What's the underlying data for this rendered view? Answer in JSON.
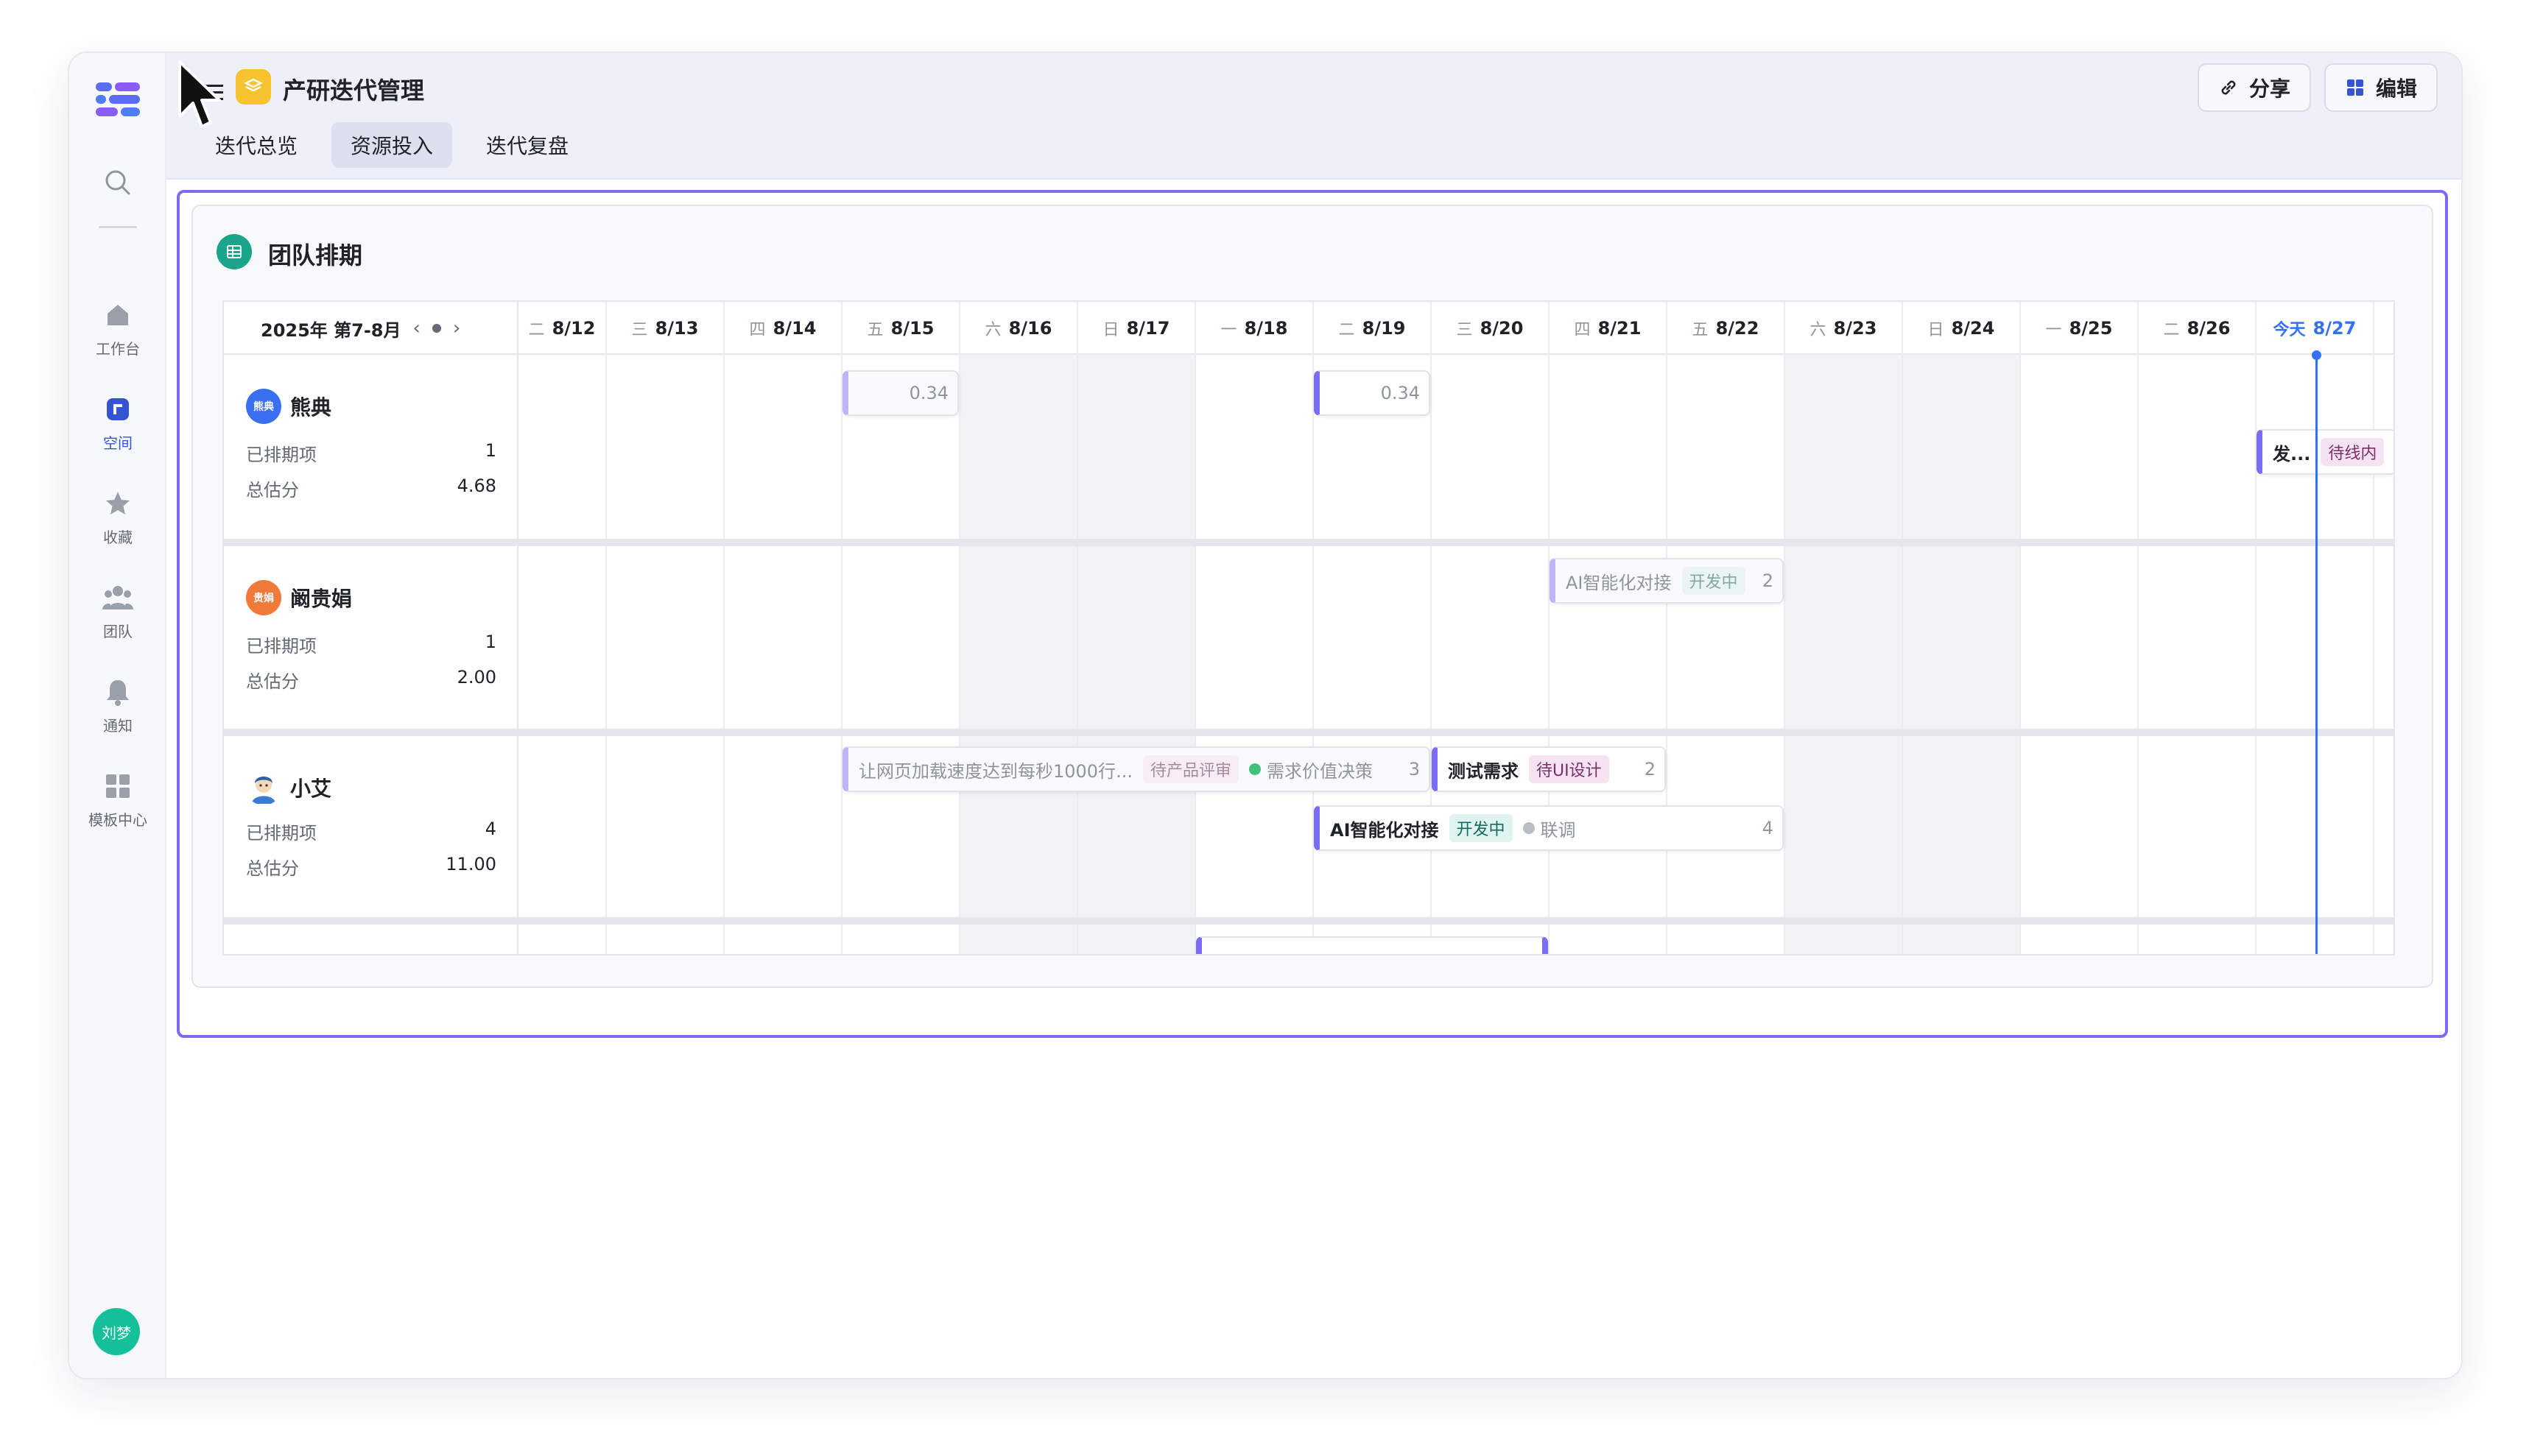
{
  "nav": {
    "items": [
      {
        "label": "工作台",
        "icon": "home-icon"
      },
      {
        "label": "空间",
        "icon": "space-icon"
      },
      {
        "label": "收藏",
        "icon": "star-icon"
      },
      {
        "label": "团队",
        "icon": "team-icon"
      },
      {
        "label": "通知",
        "icon": "bell-icon"
      },
      {
        "label": "模板中心",
        "icon": "template-icon"
      }
    ],
    "user_avatar": "刘梦"
  },
  "header": {
    "title": "产研迭代管理",
    "tabs": [
      "迭代总览",
      "资源投入",
      "迭代复盘"
    ],
    "active_tab": "资源投入",
    "share_label": "分享",
    "edit_label": "编辑"
  },
  "card": {
    "title": "团队排期"
  },
  "gantt": {
    "period": "2025年 第7-8月",
    "days": [
      {
        "wd": "二",
        "date": "8/12"
      },
      {
        "wd": "三",
        "date": "8/13"
      },
      {
        "wd": "四",
        "date": "8/14"
      },
      {
        "wd": "五",
        "date": "8/15"
      },
      {
        "wd": "六",
        "date": "8/16"
      },
      {
        "wd": "日",
        "date": "8/17"
      },
      {
        "wd": "一",
        "date": "8/18"
      },
      {
        "wd": "二",
        "date": "8/19"
      },
      {
        "wd": "三",
        "date": "8/20"
      },
      {
        "wd": "四",
        "date": "8/21"
      },
      {
        "wd": "五",
        "date": "8/22"
      },
      {
        "wd": "六",
        "date": "8/23"
      },
      {
        "wd": "日",
        "date": "8/24"
      },
      {
        "wd": "一",
        "date": "8/25"
      },
      {
        "wd": "二",
        "date": "8/26"
      },
      {
        "wd": "今天",
        "date": "8/27"
      }
    ],
    "members": [
      {
        "name": "熊典",
        "avatar_text": "熊典",
        "scheduled_label": "已排期项",
        "scheduled": "1",
        "estimate_label": "总估分",
        "estimate": "4.68"
      },
      {
        "name": "阚贵娟",
        "avatar_text": "贵娟",
        "scheduled_label": "已排期项",
        "scheduled": "1",
        "estimate_label": "总估分",
        "estimate": "2.00"
      },
      {
        "name": "小艾",
        "avatar_text": "",
        "scheduled_label": "已排期项",
        "scheduled": "4",
        "estimate_label": "总估分",
        "estimate": "11.00"
      }
    ],
    "tasks": {
      "t1": {
        "value": "0.34"
      },
      "t2": {
        "value": "0.34"
      },
      "t3": {
        "title": "发...",
        "tag": "待线内"
      },
      "t4": {
        "title": "AI智能化对接",
        "tag": "开发中",
        "value": "2"
      },
      "t5": {
        "title": "让网页加载速度达到每秒1000行...",
        "tag": "待产品评审",
        "sub": "需求价值决策",
        "value": "3"
      },
      "t6": {
        "title": "测试需求",
        "tag": "待UI设计",
        "value": "2"
      },
      "t7": {
        "title": "AI智能化对接",
        "tag": "开发中",
        "sub": "联调",
        "value": "4"
      }
    }
  },
  "colors": {
    "accent": "#7a6cf0",
    "today": "#3370ff",
    "brand_green": "#1aa58a",
    "app_yellow": "#f7c230"
  }
}
